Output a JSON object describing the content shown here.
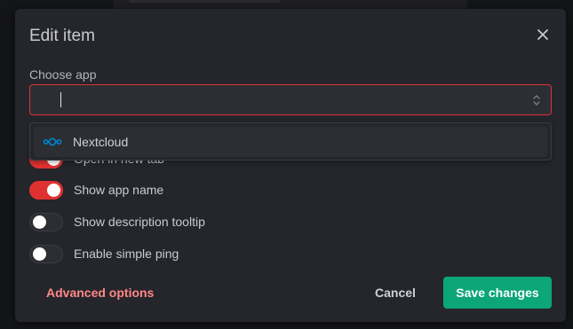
{
  "dialog": {
    "title": "Edit item",
    "choose_app_label": "Choose app",
    "choose_app_value": ""
  },
  "dropdown": {
    "options": [
      {
        "label": "Nextcloud",
        "icon": "nextcloud-icon"
      }
    ]
  },
  "toggles": [
    {
      "label": "Open in new tab",
      "checked": true
    },
    {
      "label": "Show app name",
      "checked": true
    },
    {
      "label": "Show description tooltip",
      "checked": false
    },
    {
      "label": "Enable simple ping",
      "checked": false
    }
  ],
  "footer": {
    "advanced_label": "Advanced options",
    "cancel_label": "Cancel",
    "save_label": "Save changes"
  },
  "colors": {
    "accent": "#e03131",
    "save": "#0ca678",
    "advanced": "#ff8787",
    "nextcloud_icon": "#0082c9"
  }
}
